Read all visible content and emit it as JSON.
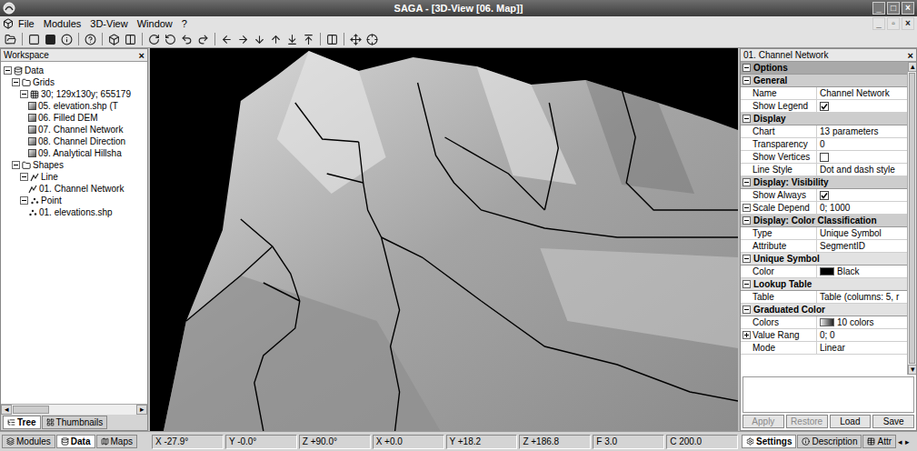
{
  "window": {
    "title": "SAGA - [3D-View [06. Map]]",
    "buttons": [
      "_",
      "□",
      "×"
    ]
  },
  "menu": {
    "items": [
      "File",
      "Modules",
      "3D-View",
      "Window",
      "?"
    ],
    "child_buttons": [
      "_",
      "▫",
      "×"
    ]
  },
  "workspace": {
    "title": "Workspace",
    "close": "×",
    "tree": [
      {
        "kind": "root",
        "label": "Data",
        "expanded": true,
        "children": [
          {
            "kind": "folder",
            "label": "Grids",
            "expanded": true,
            "children": [
              {
                "kind": "system",
                "label": "30; 129x130y; 655179",
                "expanded": true,
                "children": [
                  {
                    "kind": "grid",
                    "label": "05. elevation.shp (T"
                  },
                  {
                    "kind": "grid",
                    "label": "06. Filled DEM"
                  },
                  {
                    "kind": "grid",
                    "label": "07. Channel Network"
                  },
                  {
                    "kind": "grid",
                    "label": "08. Channel Direction"
                  },
                  {
                    "kind": "grid",
                    "label": "09. Analytical Hillsha"
                  }
                ]
              }
            ]
          },
          {
            "kind": "folder",
            "label": "Shapes",
            "expanded": true,
            "children": [
              {
                "kind": "lineset",
                "label": "Line",
                "expanded": true,
                "children": [
                  {
                    "kind": "line",
                    "label": "01. Channel Network"
                  }
                ]
              },
              {
                "kind": "pointset",
                "label": "Point",
                "expanded": true,
                "children": [
                  {
                    "kind": "point",
                    "label": "01. elevations.shp"
                  }
                ]
              }
            ]
          }
        ]
      }
    ],
    "scroll": [
      "◂",
      "▸"
    ],
    "tabs": [
      {
        "label": "Tree",
        "selected": true
      },
      {
        "label": "Thumbnails",
        "selected": false
      }
    ]
  },
  "properties": {
    "title": "01. Channel Network",
    "close": "×",
    "scroll": [
      "▴",
      "▾"
    ],
    "rows": [
      {
        "kind": "section",
        "label": "Options",
        "expanded": true
      },
      {
        "kind": "group",
        "label": "General",
        "expanded": true
      },
      {
        "kind": "text",
        "label": "Name",
        "value": "Channel Network"
      },
      {
        "kind": "check",
        "label": "Show Legend",
        "checked": true
      },
      {
        "kind": "group",
        "label": "Display",
        "expanded": true
      },
      {
        "kind": "text",
        "label": "Chart",
        "value": "13 parameters"
      },
      {
        "kind": "text",
        "label": "Transparency",
        "value": "0"
      },
      {
        "kind": "check",
        "label": "Show Vertices",
        "checked": false
      },
      {
        "kind": "text",
        "label": "Line Style",
        "value": "Dot and dash style"
      },
      {
        "kind": "group",
        "label": "Display: Visibility",
        "expanded": true
      },
      {
        "kind": "check",
        "label": "Show Always",
        "checked": true
      },
      {
        "kind": "text",
        "label": "Scale Depend",
        "value": "0; 1000",
        "expanded": true
      },
      {
        "kind": "group",
        "label": "Display: Color Classification",
        "expanded": true
      },
      {
        "kind": "text",
        "label": "Type",
        "value": "Unique Symbol"
      },
      {
        "kind": "text",
        "label": "Attribute",
        "value": "SegmentID"
      },
      {
        "kind": "subgroup",
        "label": "Unique Symbol",
        "expanded": true
      },
      {
        "kind": "color",
        "label": "Color",
        "value": "Black",
        "color": "#000000"
      },
      {
        "kind": "subgroup",
        "label": "Lookup Table",
        "expanded": true
      },
      {
        "kind": "text",
        "label": "Table",
        "value": "Table (columns: 5, r"
      },
      {
        "kind": "subgroup",
        "label": "Graduated Color",
        "expanded": true
      },
      {
        "kind": "gradient",
        "label": "Colors",
        "value": "10 colors",
        "colors": [
          "#f0f0f0",
          "#202020"
        ]
      },
      {
        "kind": "text",
        "label": "Value Rang",
        "value": "0; 0",
        "expanded": false
      },
      {
        "kind": "text",
        "label": "Mode",
        "value": "Linear"
      }
    ],
    "buttons": [
      {
        "label": "Apply",
        "disabled": true
      },
      {
        "label": "Restore",
        "disabled": true
      },
      {
        "label": "Load",
        "disabled": false
      },
      {
        "label": "Save",
        "disabled": false
      }
    ]
  },
  "status_bar": {
    "tabs": [
      {
        "label": "Modules",
        "selected": false
      },
      {
        "label": "Data",
        "selected": true
      },
      {
        "label": "Maps",
        "selected": false
      }
    ],
    "fields": [
      "X -27.9°",
      "Y -0.0°",
      "Z +90.0°",
      "X +0.0",
      "Y +18.2",
      "Z +186.8",
      "F 3.0",
      "C 200.0"
    ],
    "right_tabs": [
      {
        "label": "Settings",
        "selected": true
      },
      {
        "label": "Description",
        "selected": false
      },
      {
        "label": "Attr",
        "selected": false
      }
    ],
    "right_scroll": [
      "◂",
      "▸"
    ]
  }
}
